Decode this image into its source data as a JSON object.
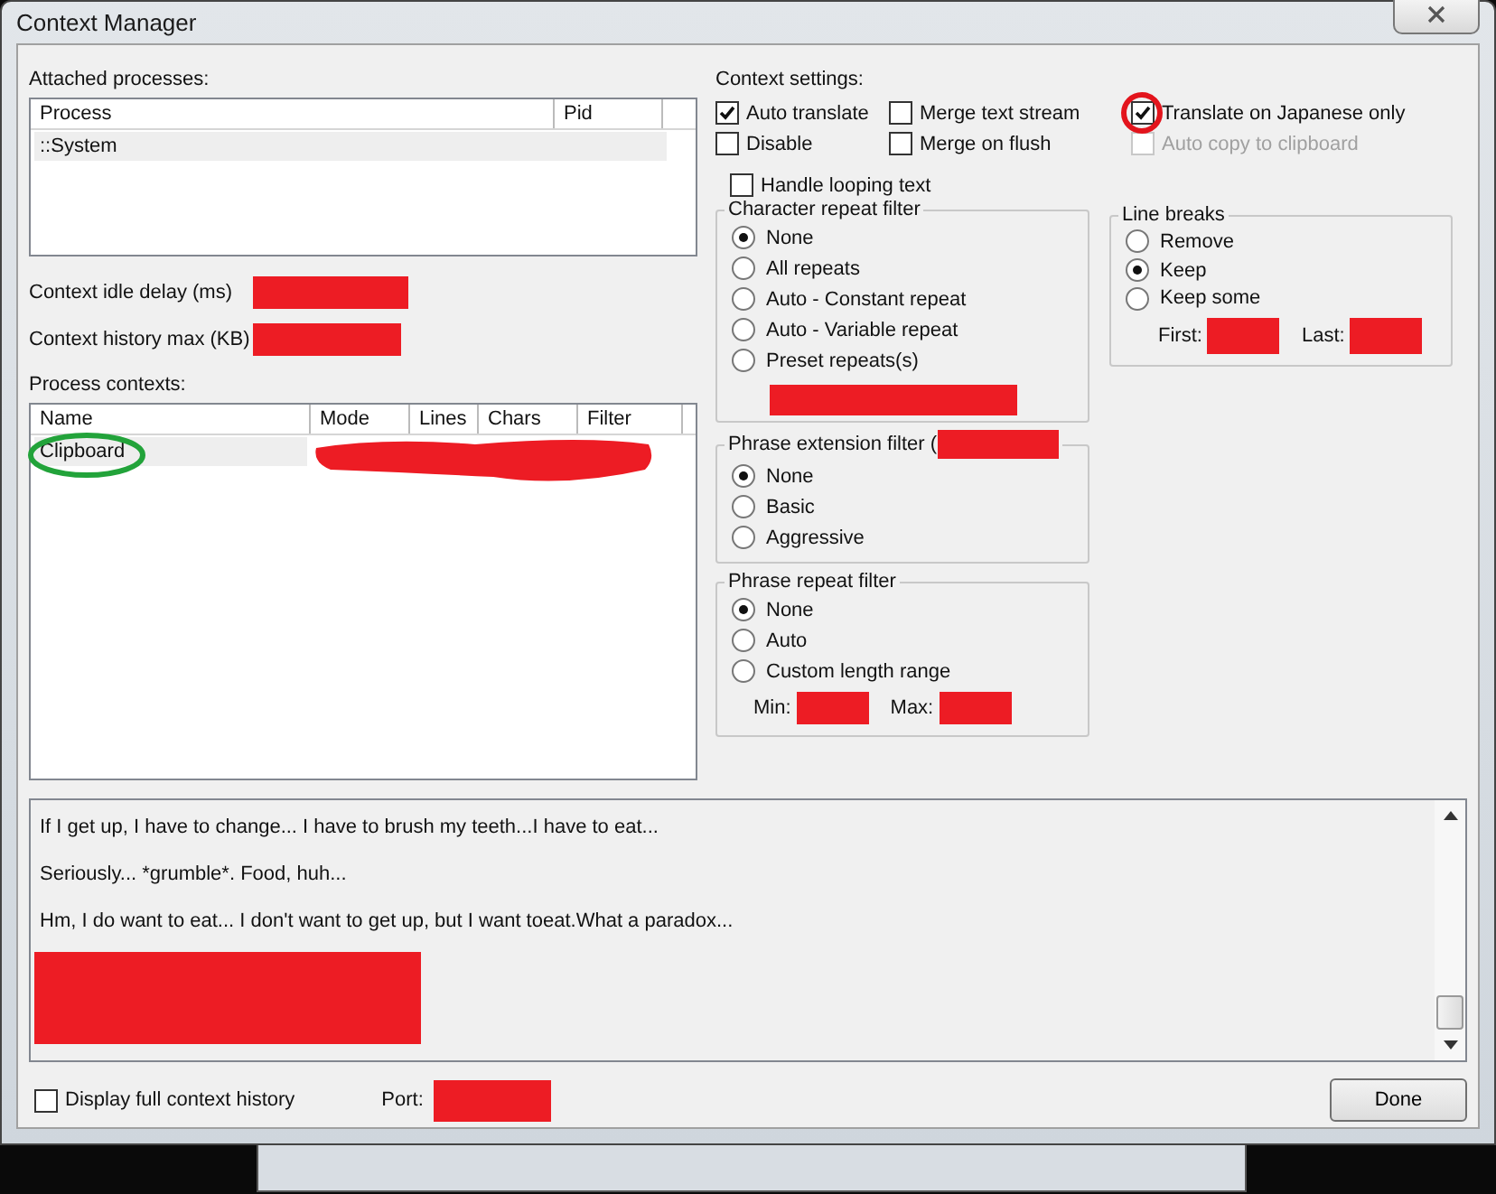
{
  "window": {
    "title": "Context Manager"
  },
  "attached_processes": {
    "label": "Attached processes:",
    "columns": [
      "Process",
      "Pid"
    ],
    "rows": [
      {
        "process": "::System",
        "selected": true
      }
    ]
  },
  "context_idle_delay": {
    "label": "Context idle delay (ms)"
  },
  "context_history_max": {
    "label": "Context history max (KB)"
  },
  "process_contexts": {
    "label": "Process contexts:",
    "columns": [
      "Name",
      "Mode",
      "Lines",
      "Chars",
      "Filter"
    ],
    "rows": [
      {
        "name": "Clipboard",
        "selected": true
      }
    ]
  },
  "context_settings": {
    "label": "Context settings:",
    "checkboxes": [
      {
        "label": "Auto translate",
        "checked": true,
        "disabled": false
      },
      {
        "label": "Merge text stream",
        "checked": false,
        "disabled": false
      },
      {
        "label": "Translate on Japanese only",
        "checked": true,
        "disabled": false
      },
      {
        "label": "Disable",
        "checked": false,
        "disabled": false
      },
      {
        "label": "Merge on flush",
        "checked": false,
        "disabled": false
      },
      {
        "label": "Auto copy to clipboard",
        "checked": false,
        "disabled": true
      }
    ]
  },
  "handle_looping_text": {
    "label": "Handle looping text",
    "checked": false
  },
  "character_repeat_filter": {
    "title": "Character repeat filter",
    "options": [
      {
        "label": "None",
        "selected": true
      },
      {
        "label": "All repeats",
        "selected": false
      },
      {
        "label": "Auto - Constant repeat",
        "selected": false
      },
      {
        "label": "Auto - Variable repeat",
        "selected": false
      },
      {
        "label": "Preset repeats(s)",
        "selected": false
      }
    ]
  },
  "line_breaks": {
    "title": "Line breaks",
    "options": [
      {
        "label": "Remove",
        "selected": false
      },
      {
        "label": "Keep",
        "selected": true
      },
      {
        "label": "Keep some",
        "selected": false
      }
    ],
    "first_label": "First:",
    "last_label": "Last:"
  },
  "phrase_extension_filter": {
    "title": "Phrase extension filter (",
    "options": [
      {
        "label": "None",
        "selected": true
      },
      {
        "label": "Basic",
        "selected": false
      },
      {
        "label": "Aggressive",
        "selected": false
      }
    ]
  },
  "phrase_repeat_filter": {
    "title": "Phrase repeat filter",
    "options": [
      {
        "label": "None",
        "selected": true
      },
      {
        "label": "Auto",
        "selected": false
      },
      {
        "label": "Custom length range",
        "selected": false
      }
    ],
    "min_label": "Min:",
    "max_label": "Max:"
  },
  "context_history": {
    "lines": [
      "If I get up, I have to change... I have to brush my teeth...I have to eat...",
      "Seriously... *grumble*. Food, huh...",
      "Hm, I do want to eat... I don't want to get up, but I want toeat.What a paradox..."
    ]
  },
  "display_full_context_history": {
    "label": "Display full context history",
    "checked": false
  },
  "port": {
    "label": "Port:"
  },
  "buttons": [
    "Done"
  ]
}
